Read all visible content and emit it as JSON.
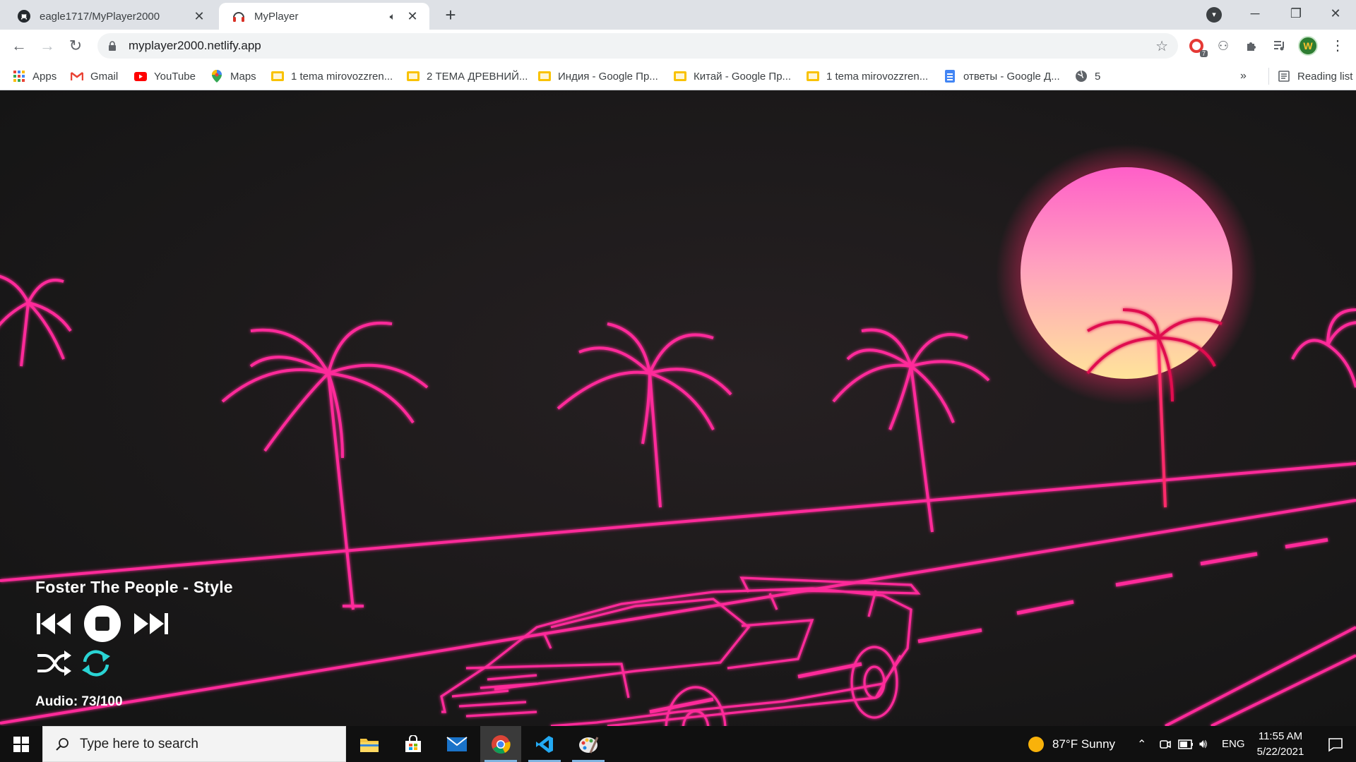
{
  "browser": {
    "tabs": [
      {
        "title": "eagle1717/MyPlayer2000",
        "icon": "github-icon",
        "active": false
      },
      {
        "title": "MyPlayer",
        "icon": "headphones-icon",
        "active": true,
        "audio_indicator": "speaker-icon"
      }
    ],
    "new_tab_label": "+",
    "url": "myplayer2000.netlify.app",
    "extension_badge": "7",
    "profile_initial": "W",
    "bookmarks": [
      {
        "label": "Apps",
        "icon": "apps-grid-icon"
      },
      {
        "label": "Gmail",
        "icon": "gmail-icon"
      },
      {
        "label": "YouTube",
        "icon": "youtube-icon"
      },
      {
        "label": "Maps",
        "icon": "maps-pin-icon"
      },
      {
        "label": "1 tema mirovozzren...",
        "icon": "slides-icon"
      },
      {
        "label": "2 ТЕМА ДРЕВНИЙ...",
        "icon": "slides-icon"
      },
      {
        "label": "Индия - Google Пр...",
        "icon": "slides-icon"
      },
      {
        "label": "Китай - Google Пр...",
        "icon": "slides-icon"
      },
      {
        "label": "1 tema mirovozzren...",
        "icon": "slides-icon"
      },
      {
        "label": "ответы - Google Д...",
        "icon": "docs-icon"
      },
      {
        "label": "5",
        "icon": "globe-icon"
      }
    ],
    "more_bookmarks": "»",
    "reading_list": "Reading list"
  },
  "player": {
    "song_title": "Foster The People - Style",
    "volume_label": "Audio: 73/100",
    "repeat_active_color": "#2ad4d4"
  },
  "taskbar": {
    "search_placeholder": "Type here to search",
    "weather": "87°F  Sunny",
    "language": "ENG",
    "time": "11:55 AM",
    "date": "5/22/2021",
    "apps": [
      "file-explorer-icon",
      "store-icon",
      "mail-icon",
      "chrome-icon",
      "vscode-icon",
      "paint-icon"
    ]
  },
  "colors": {
    "neon_pink": "#ff2a9a",
    "sun_top": "#ff6fd0",
    "sun_bottom": "#ffe08a",
    "background": "#1b1b1b"
  }
}
